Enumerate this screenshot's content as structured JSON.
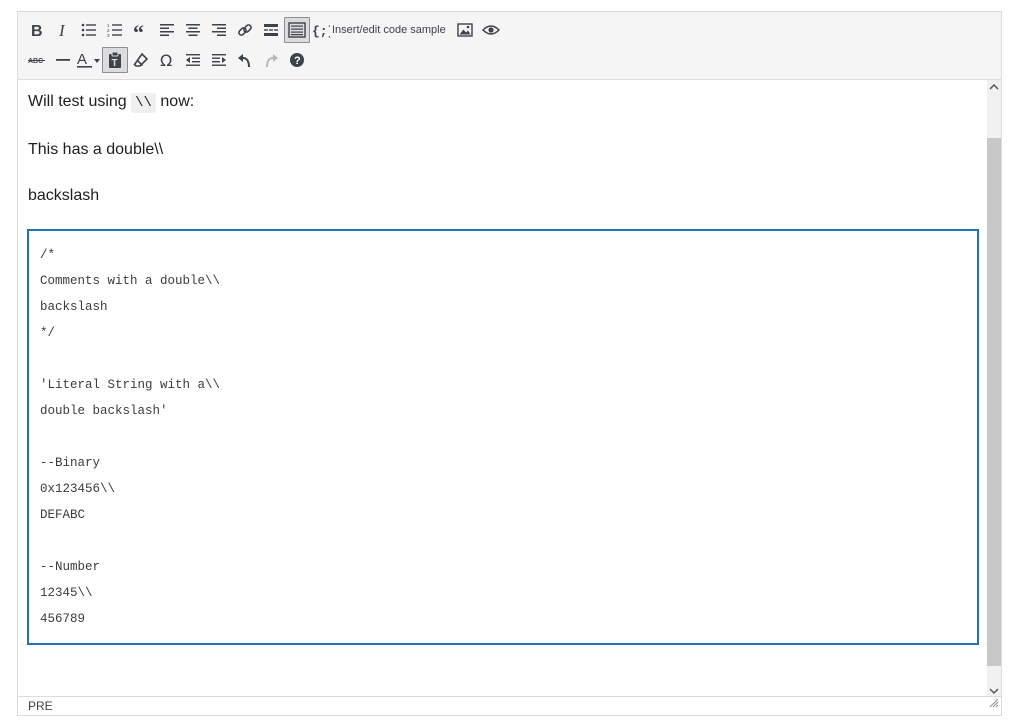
{
  "toolbar": {
    "row1": [
      {
        "icon": "bold-icon"
      },
      {
        "icon": "italic-icon"
      },
      {
        "icon": "bullet-list-icon"
      },
      {
        "icon": "numbered-list-icon"
      },
      {
        "icon": "blockquote-icon"
      },
      {
        "icon": "align-left-icon"
      },
      {
        "icon": "align-center-icon"
      },
      {
        "icon": "align-right-icon"
      },
      {
        "icon": "link-icon"
      },
      {
        "icon": "read-more-icon"
      },
      {
        "icon": "toolbar-toggle-icon",
        "active": true
      },
      {
        "icon": "code-sample-icon",
        "label": "Insert/edit code sample"
      },
      {
        "icon": "image-icon"
      },
      {
        "icon": "preview-icon"
      }
    ],
    "row2": [
      {
        "icon": "strikethrough-icon"
      },
      {
        "icon": "horizontal-line-icon"
      },
      {
        "icon": "text-color-icon"
      },
      {
        "icon": "paste-as-text-icon",
        "active": true
      },
      {
        "icon": "clear-formatting-icon"
      },
      {
        "icon": "special-character-icon"
      },
      {
        "icon": "outdent-icon"
      },
      {
        "icon": "indent-icon"
      },
      {
        "icon": "undo-icon"
      },
      {
        "icon": "redo-icon",
        "disabled": true
      },
      {
        "icon": "help-icon"
      }
    ],
    "code_sample_label": "Insert/edit code sample"
  },
  "content": {
    "para1_before": "Will test using ",
    "para1_code": "\\\\",
    "para1_after": " now:",
    "para2": "This has a double\\\\",
    "para3": "backslash",
    "code_lines": [
      "/*",
      "Comments with a double\\\\",
      "backslash",
      "*/",
      "",
      "'Literal String with a\\\\",
      "double backslash'",
      "",
      "--Binary",
      "0x123456\\\\",
      "DEFABC",
      "",
      "--Number",
      "12345\\\\",
      "456789"
    ]
  },
  "statusbar": {
    "path": "PRE"
  },
  "colors": {
    "accent": "#2271b1",
    "toolbar_bg": "#f5f5f5",
    "border": "#dcdcde"
  }
}
